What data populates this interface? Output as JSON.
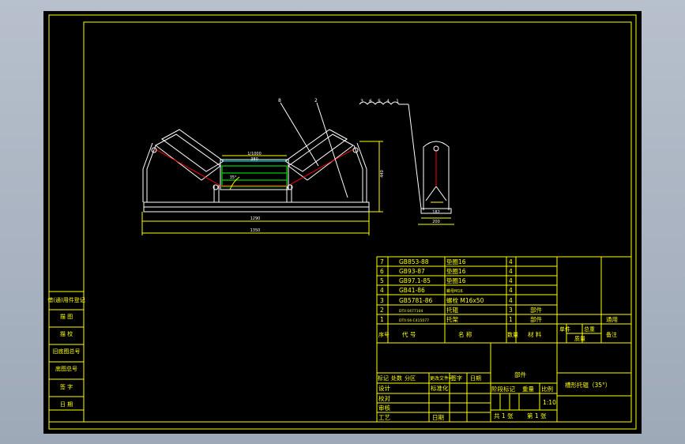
{
  "colors": {
    "background": "#000000",
    "border": "#ffff00",
    "drawing_white": "#ffffff",
    "highlight_red": "#ff0000",
    "highlight_green": "#00ff00",
    "highlight_cyan": "#00ffff"
  },
  "front_view": {
    "dim_top": "1/1000",
    "dim_middle": "380",
    "dim_angle": "35°",
    "dim_bottom_inner": "1290",
    "dim_bottom_outer": "1350",
    "dim_height": "440"
  },
  "side_view": {
    "dim_inner": "182",
    "dim_outer": "200"
  },
  "callouts": {
    "front_left": "8",
    "front_right": "2",
    "side_group": [
      "3",
      "6",
      "5",
      "4",
      "1"
    ]
  },
  "bom": {
    "rows": [
      {
        "seq": "7",
        "code": "GB853-88",
        "name": "垫圈16",
        "qty": "4",
        "material": "",
        "weight": "",
        "note": ""
      },
      {
        "seq": "6",
        "code": "GB93-87",
        "name": "垫圈16",
        "qty": "4",
        "material": "",
        "weight": "",
        "note": ""
      },
      {
        "seq": "5",
        "code": "GB97.1-85",
        "name": "垫圈16",
        "qty": "4",
        "material": "",
        "weight": "",
        "note": ""
      },
      {
        "seq": "4",
        "code": "GB41-86",
        "name": "螺母M16",
        "qty": "4",
        "material": "",
        "weight": "",
        "note": ""
      },
      {
        "seq": "3",
        "code": "GB5781-86",
        "name": "螺栓 M16x50",
        "qty": "4",
        "material": "",
        "weight": "",
        "note": ""
      },
      {
        "seq": "2",
        "code": "DTII 0477104",
        "name": "托辊",
        "qty": "3",
        "material": "部件",
        "weight": "",
        "note": ""
      },
      {
        "seq": "1",
        "code": "DTII 04-C415077",
        "name": "托架",
        "qty": "1",
        "material": "部件",
        "weight": "",
        "note": "通用"
      }
    ],
    "header": {
      "seq": "序号",
      "code": "代  号",
      "name": "名  称",
      "qty": "数量",
      "material": "材  料",
      "unit_weight": "单件",
      "total_weight": "总重",
      "weight_label": "质量",
      "note": "备注"
    }
  },
  "title_block": {
    "material_cell": "部件",
    "drawing_title": "槽形托辊（35°）",
    "revision_labels": [
      "标记",
      "处数",
      "分区",
      "更改文件号",
      "签字",
      "日期"
    ],
    "designer": "设计",
    "standardization": "标准化",
    "checker": "校对",
    "reviewer": "审核",
    "process": "工艺",
    "date": "日期",
    "stage_label": "阶段标记",
    "weight_label": "重量",
    "scale_label": "比例",
    "scale": "1:10",
    "sheets": "共 1 张",
    "sheet_no": "第 1 张"
  },
  "left_strip": {
    "labels": [
      "借(通)用件登记",
      "描  图",
      "描  校",
      "旧底图总号",
      "底图总号",
      "签  字",
      "日  期"
    ]
  }
}
